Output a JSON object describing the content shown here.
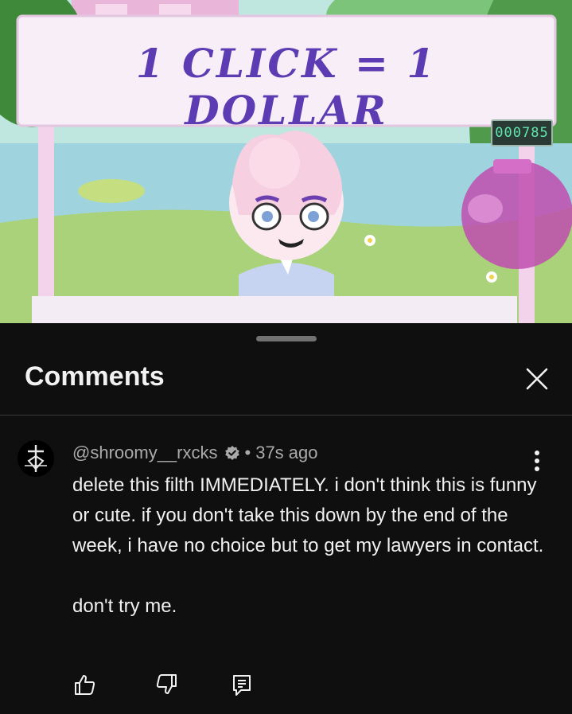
{
  "video": {
    "sign_text": "1 CLICK = 1 DOLLAR",
    "counter": "000785"
  },
  "comments_panel": {
    "title": "Comments",
    "close_icon": "close-icon"
  },
  "comment": {
    "author": "@shroomy__rxcks",
    "separator": "•",
    "time": "37s ago",
    "body": "delete this filth IMMEDIATELY. i don't think this is funny or cute. if you don't take this down by the end of the week, i have no choice but to get my lawyers in contact.\n\ndon't try me.",
    "icons": {
      "verified": "verified-badge-icon",
      "more": "more-vert-icon",
      "like": "thumbs-up-icon",
      "dislike": "thumbs-down-icon",
      "reply": "reply-icon"
    }
  },
  "colors": {
    "background": "#0f0f0f",
    "text_primary": "#f1f1f1",
    "text_secondary": "#aaaaaa",
    "sign_text": "#5c3bb3"
  }
}
